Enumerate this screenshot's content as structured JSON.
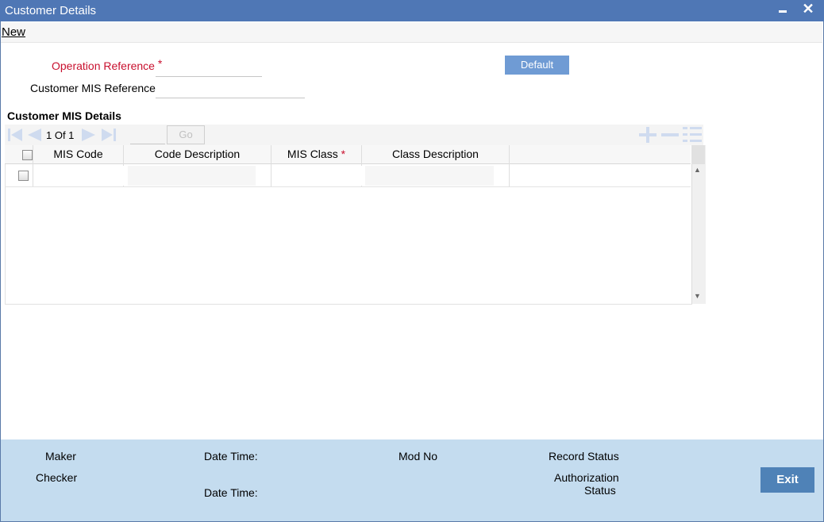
{
  "window": {
    "title": "Customer Details"
  },
  "menu": {
    "new_label": "New"
  },
  "form": {
    "operation_reference_label": "Operation Reference",
    "operation_reference_value": "",
    "customer_mis_reference_label": "Customer MIS Reference",
    "customer_mis_reference_value": "",
    "default_button": "Default",
    "required_marker": "*"
  },
  "section": {
    "title": "Customer MIS Details"
  },
  "pager": {
    "page_text": "1 Of 1",
    "go_label": "Go",
    "page_input": ""
  },
  "grid": {
    "columns": [
      "MIS Code",
      "Code Description",
      "MIS Class",
      "Class Description"
    ],
    "required_marker": "*",
    "rows": [
      {
        "mis_code": "",
        "code_description": "",
        "mis_class": "",
        "class_description": ""
      }
    ]
  },
  "footer": {
    "maker_label": "Maker",
    "checker_label": "Checker",
    "date_time_label": "Date Time:",
    "mod_no_label": "Mod No",
    "record_status_label": "Record Status",
    "authorization_label": "Authorization",
    "status_label": "Status",
    "exit_button": "Exit"
  },
  "colors": {
    "titlebar": "#4f77b5",
    "required": "#c8102e",
    "default_button": "#6f9bd4",
    "footer": "#c4dcef",
    "exit_button": "#4f82b7"
  },
  "icons": [
    "minimize-icon",
    "close-icon",
    "first-page-icon",
    "prev-page-icon",
    "next-page-icon",
    "last-page-icon",
    "add-row-icon",
    "delete-row-icon",
    "single-view-icon",
    "scroll-up-icon",
    "scroll-down-icon"
  ]
}
